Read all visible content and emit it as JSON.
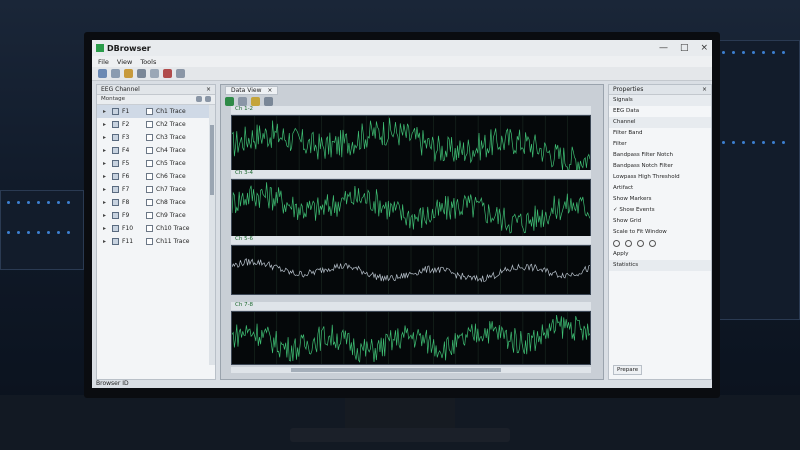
{
  "window": {
    "title": "DBrowser",
    "controls": [
      "—",
      "□",
      "×"
    ]
  },
  "menu": [
    "File",
    "View",
    "Tools"
  ],
  "left_panel": {
    "title": "EEG Channel",
    "subtitle": "Montage",
    "close": "×",
    "rows": [
      {
        "ch": "F1",
        "label": "Ch1 Trace"
      },
      {
        "ch": "F2",
        "label": "Ch2 Trace"
      },
      {
        "ch": "F3",
        "label": "Ch3 Trace"
      },
      {
        "ch": "F4",
        "label": "Ch4 Trace"
      },
      {
        "ch": "F5",
        "label": "Ch5 Trace"
      },
      {
        "ch": "F6",
        "label": "Ch6 Trace"
      },
      {
        "ch": "F7",
        "label": "Ch7 Trace"
      },
      {
        "ch": "F8",
        "label": "Ch8 Trace"
      },
      {
        "ch": "F9",
        "label": "Ch9 Trace"
      },
      {
        "ch": "F10",
        "label": "Ch10 Trace"
      },
      {
        "ch": "F11",
        "label": "Ch11 Trace"
      }
    ],
    "status": "Browser ID"
  },
  "center": {
    "tab": "Data View",
    "close": "×",
    "traces": [
      {
        "label": "Ch 1-2",
        "color": "#3fbf74"
      },
      {
        "label": "Ch 3-4",
        "color": "#3fbf74"
      },
      {
        "label": "Ch 5-6",
        "color": "#b8c2cc"
      },
      {
        "label": "Ch 7-8",
        "color": "#3fbf74"
      }
    ]
  },
  "right_panel": {
    "title": "Properties",
    "close": "×",
    "rows": [
      {
        "text": "Signals",
        "hdr": true
      },
      {
        "text": "EEG Data",
        "hdr": false
      },
      {
        "text": "Channel",
        "hdr": true
      },
      {
        "text": "Filter Band",
        "hdr": false
      },
      {
        "text": "Filter",
        "hdr": false
      },
      {
        "text": "Bandpass Filter Notch",
        "hdr": false
      },
      {
        "text": "Bandpass Notch Filter",
        "hdr": false
      },
      {
        "text": "Lowpass  High  Threshold",
        "hdr": false
      },
      {
        "text": "Artifact",
        "hdr": false
      },
      {
        "text": "Show Markers",
        "hdr": false
      },
      {
        "text": "✓ Show Events",
        "hdr": false
      },
      {
        "text": "Show Grid",
        "hdr": false
      },
      {
        "text": "Scale to Fit Window",
        "hdr": false
      },
      {
        "text": "Apply",
        "hdr": false
      },
      {
        "text": "Statistics",
        "hdr": true
      }
    ],
    "footer": "Prepare"
  },
  "colors": {
    "accent": "#3fbf74",
    "trace_bg": "#05080a"
  }
}
